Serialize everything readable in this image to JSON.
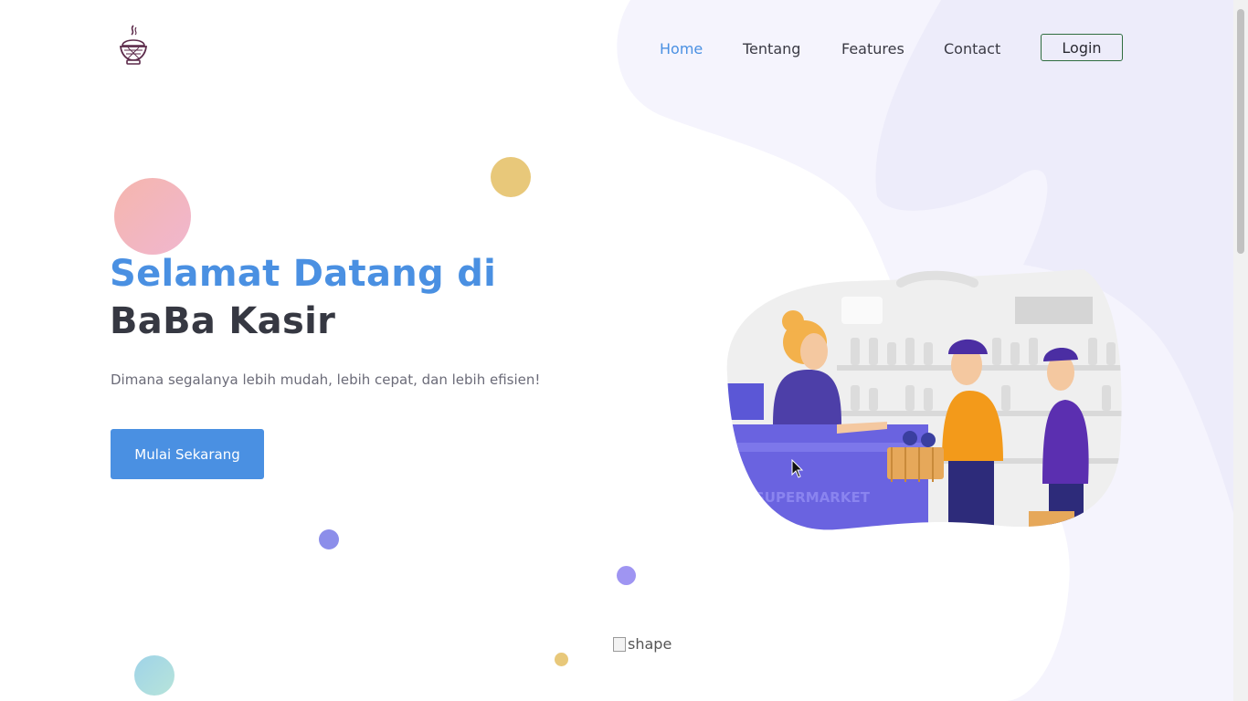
{
  "brand": {
    "logo_icon": "rice-bowl-logo-icon"
  },
  "nav": {
    "items": [
      {
        "label": "Home",
        "active": true
      },
      {
        "label": "Tentang",
        "active": false
      },
      {
        "label": "Features",
        "active": false
      },
      {
        "label": "Contact",
        "active": false
      }
    ],
    "login_label": "Login"
  },
  "hero": {
    "title_line1": "Selamat Datang di",
    "title_line2": "BaBa Kasir",
    "subtitle": "Dimana segalanya lebih mudah, lebih cepat, dan lebih efisien!",
    "cta_label": "Mulai Sekarang",
    "illustration_icon": "supermarket-cashier-illustration",
    "illustration_text": "SUPERMARKET"
  },
  "decor": {
    "broken_image_alt": "shape"
  },
  "colors": {
    "primary": "#4a90e2",
    "heading_dark": "#363842",
    "text_muted": "#6b6b78",
    "blob": "#f4f3fd",
    "bubble_pink": "#f2b8c0",
    "bubble_gold": "#e8c87a",
    "bubble_purple": "#8f8ff0",
    "bubble_teal": "#a6dbe3"
  }
}
